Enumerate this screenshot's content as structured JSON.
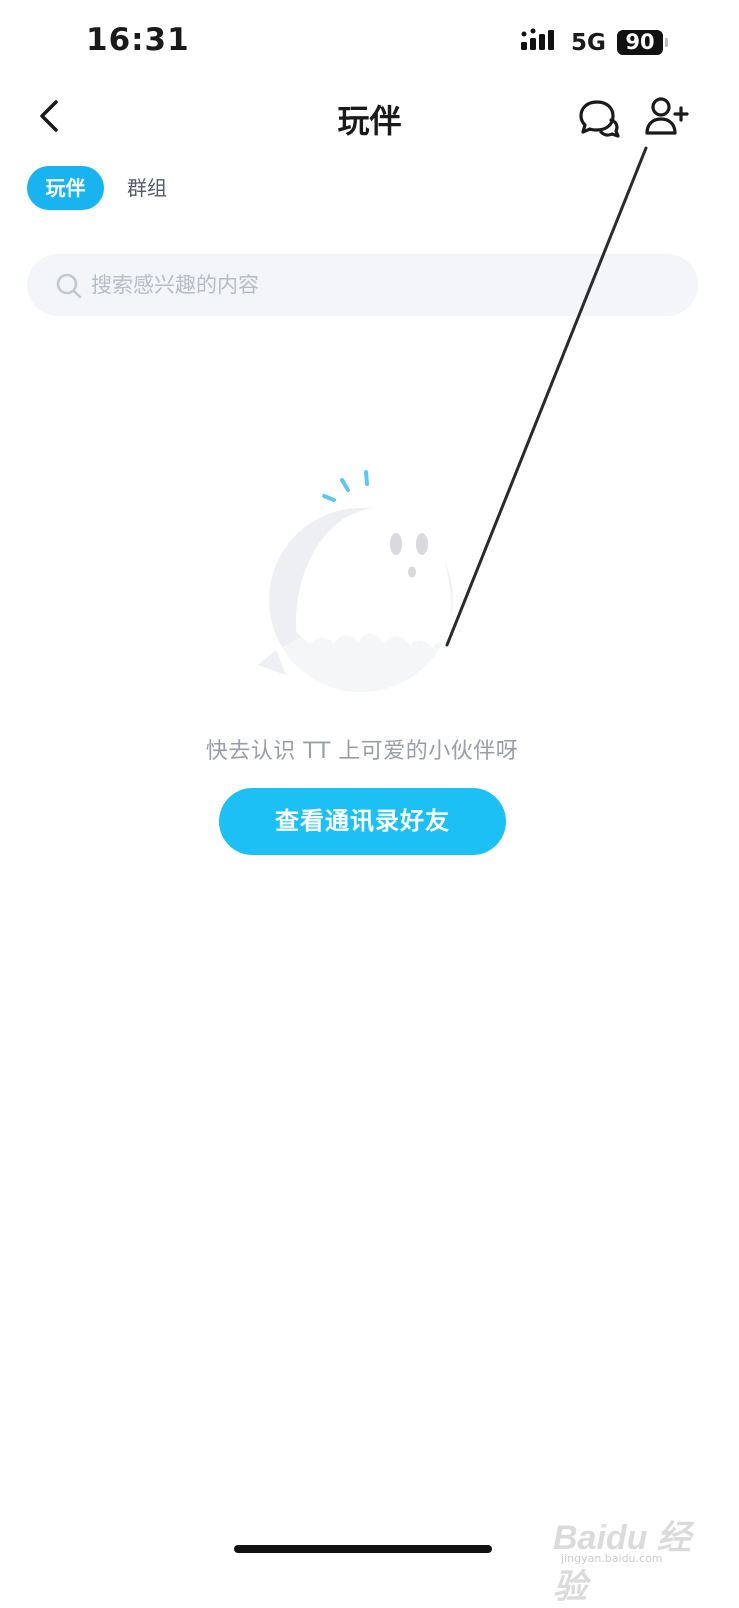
{
  "status_bar": {
    "time": "16:31",
    "network": "5G",
    "battery": "90"
  },
  "nav": {
    "title": "玩伴",
    "back_icon": "chevron-left-icon",
    "chat_icon": "chat-bubbles-icon",
    "add_friend_icon": "user-plus-icon"
  },
  "tabs": [
    {
      "label": "玩伴",
      "active": true
    },
    {
      "label": "群组",
      "active": false
    }
  ],
  "search": {
    "placeholder": "搜索感兴趣的内容",
    "icon": "search-icon"
  },
  "empty_state": {
    "illustration": "ghost-icon",
    "message": "快去认识 TT 上可爱的小伙伴呀",
    "button_label": "查看通讯录好友"
  },
  "watermark": {
    "logo": "Baidu 经验",
    "subtext": "jingyan.baidu.com"
  },
  "colors": {
    "accent": "#19b4ef",
    "button": "#1cc0f5",
    "search_bg": "#f3f5f9",
    "muted_text": "#9a9ea6"
  }
}
